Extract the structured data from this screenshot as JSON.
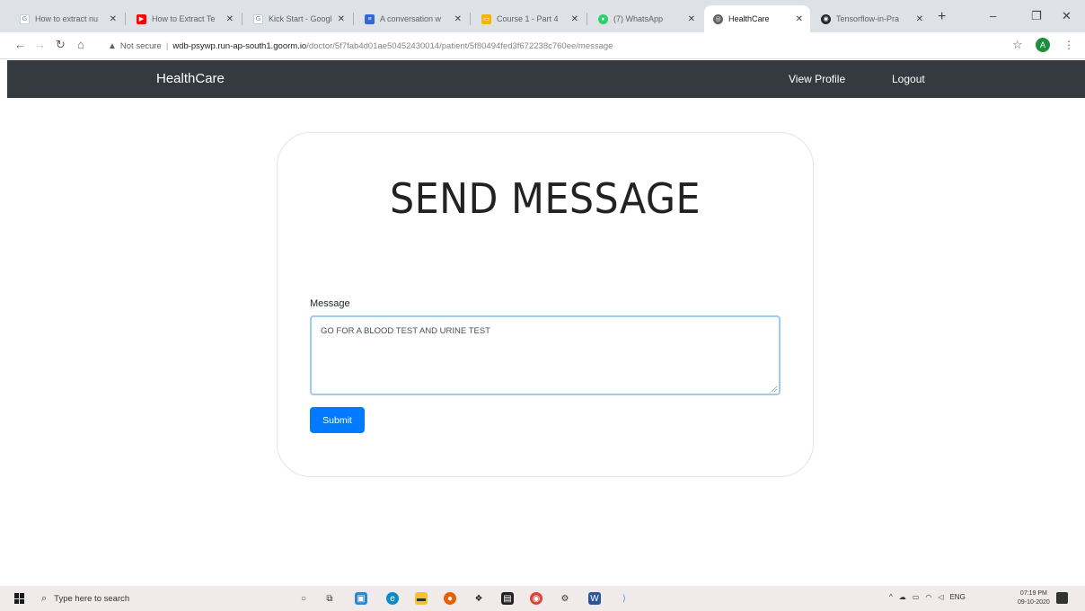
{
  "browser": {
    "tabs": [
      {
        "title": "How to extract nu",
        "favicon": "google-icon",
        "color": "#4285f4"
      },
      {
        "title": "How to Extract Te",
        "favicon": "youtube-icon",
        "color": "#ff0000"
      },
      {
        "title": "Kick Start - Googl",
        "favicon": "google-icon",
        "color": "#4285f4"
      },
      {
        "title": "A conversation w",
        "favicon": "mail-icon",
        "color": "#3367d6"
      },
      {
        "title": "Course 1 - Part 4",
        "favicon": "course-icon",
        "color": "#f4b400"
      },
      {
        "title": "(7) WhatsApp",
        "favicon": "whatsapp-icon",
        "color": "#25d366"
      },
      {
        "title": "HealthCare",
        "favicon": "globe-icon",
        "color": "#5f6368",
        "active": true
      },
      {
        "title": "Tensorflow-in-Pra",
        "favicon": "github-icon",
        "color": "#24292e"
      }
    ],
    "address": {
      "security": "Not secure",
      "host": "wdb-psywp.run-ap-south1.goorm.io",
      "path": "/doctor/5f7fab4d01ae50452430014/patient/5f80494fed3f672238c760ee/message"
    },
    "profile_initial": "A"
  },
  "app": {
    "brand": "HealthCare",
    "nav": {
      "view_profile": "View Profile",
      "logout": "Logout"
    },
    "form": {
      "title": "SEND MESSAGE",
      "message_label": "Message",
      "message_value": "GO FOR A BLOOD TEST AND URINE TEST",
      "submit_label": "Submit"
    }
  },
  "taskbar": {
    "search_placeholder": "Type here to search",
    "language": "ENG",
    "time": "07:19 PM",
    "date": "09-10-2020"
  }
}
